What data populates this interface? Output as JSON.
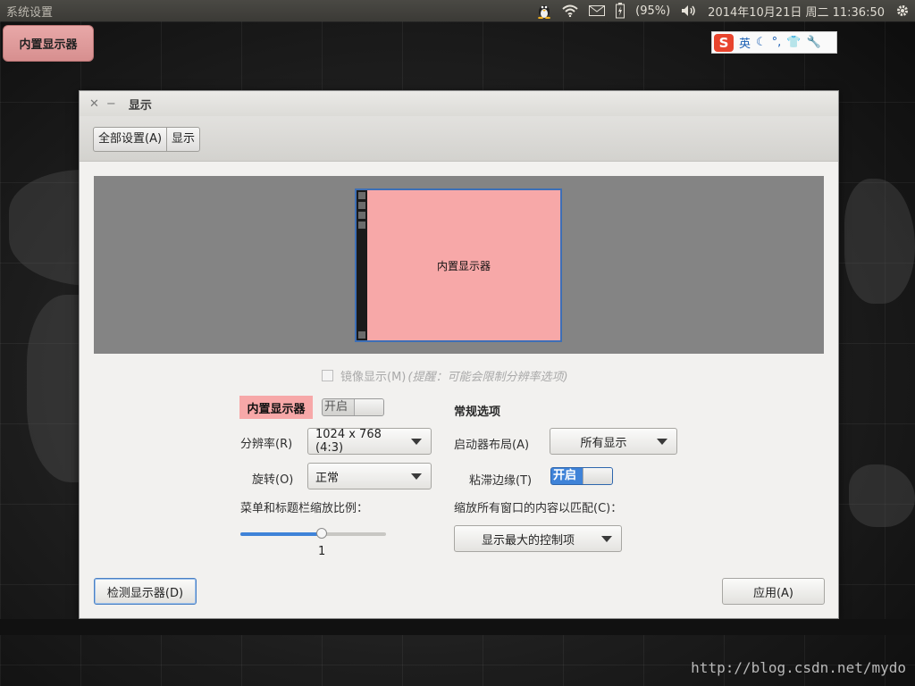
{
  "top_panel": {
    "title": "系统设置",
    "battery": "(95%)",
    "clock": "2014年10月21日 周二 11:36:50",
    "icons": [
      "tux-icon",
      "wifi-icon",
      "mail-icon",
      "battery-icon",
      "volume-icon",
      "gear-icon"
    ]
  },
  "launcher": {
    "label": "内置显示器"
  },
  "ime": {
    "logo": "S",
    "mode": "英",
    "items": [
      "☾",
      "°,",
      "👕",
      "🔧"
    ]
  },
  "window": {
    "title": "显示",
    "breadcrumbs": [
      "全部设置(A)",
      "显示"
    ],
    "monitor_label": "内置显示器",
    "mirror": {
      "label": "镜像显示(M)",
      "note": "(提醒：可能会限制分辨率选项)",
      "checked": false
    },
    "display_name": "内置显示器",
    "display_switch": {
      "label": "开启",
      "state": "off"
    },
    "resolution": {
      "label": "分辨率(R)",
      "value": "1024 x 768 (4:3)"
    },
    "rotation": {
      "label": "旋转(O)",
      "value": "正常"
    },
    "scale": {
      "label": "菜单和标题栏缩放比例：",
      "value": "1",
      "fraction": 0.56
    },
    "general": {
      "heading": "常规选项",
      "launcher_layout": {
        "label": "启动器布局(A)",
        "value": "所有显示"
      },
      "sticky_edges": {
        "label": "粘滞边缘(T)",
        "switch_label": "开启",
        "state": "on"
      },
      "scale_windows": {
        "label": "缩放所有窗口的内容以匹配(C)：",
        "value": "显示最大的控制项"
      }
    },
    "detect_button": "检测显示器(D)",
    "apply_button": "应用(A)"
  },
  "watermark": "http://blog.csdn.net/mydo"
}
